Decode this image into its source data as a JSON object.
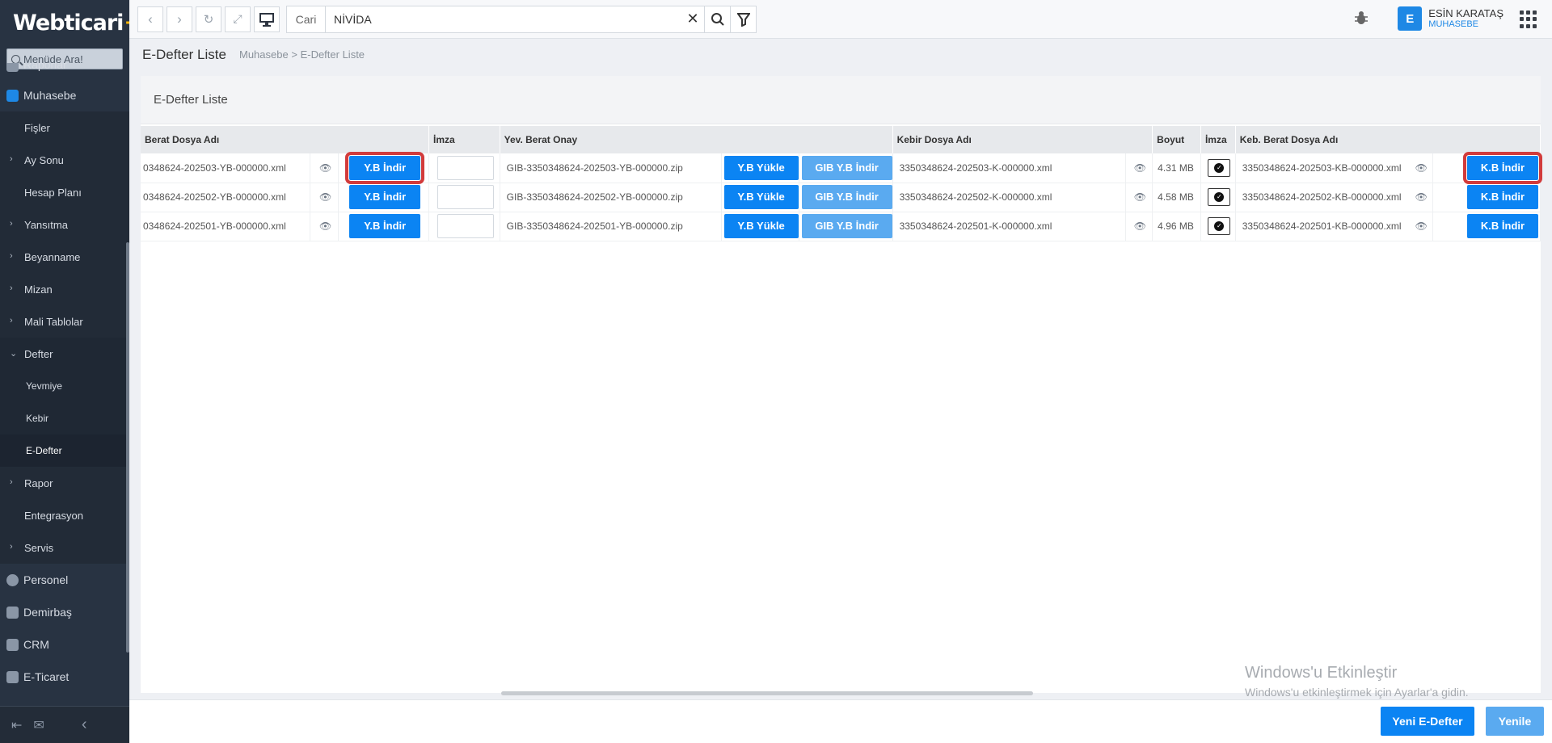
{
  "app": {
    "logo_text": "Webticari",
    "logo_plus": "+"
  },
  "sidebar": {
    "search_placeholder": "Menüde Ara!",
    "items": [
      {
        "label": "Raporlar"
      },
      {
        "label": "Muhasebe"
      },
      {
        "label": "Fişler"
      },
      {
        "label": "Ay Sonu"
      },
      {
        "label": "Hesap Planı"
      },
      {
        "label": "Yansıtma"
      },
      {
        "label": "Beyanname"
      },
      {
        "label": "Mizan"
      },
      {
        "label": "Mali Tablolar"
      },
      {
        "label": "Defter"
      },
      {
        "label": "Yevmiye"
      },
      {
        "label": "Kebir"
      },
      {
        "label": "E-Defter"
      },
      {
        "label": "Rapor"
      },
      {
        "label": "Entegrasyon"
      },
      {
        "label": "Servis"
      },
      {
        "label": "Personel"
      },
      {
        "label": "Demirbaş"
      },
      {
        "label": "CRM"
      },
      {
        "label": "E-Ticaret"
      }
    ]
  },
  "topbar": {
    "search_label": "Cari",
    "search_value": "NİVİDA",
    "user_initial": "E",
    "user_name": "ESİN KARATAŞ",
    "user_role": "MUHASEBE"
  },
  "page": {
    "title": "E-Defter Liste",
    "breadcrumb_1": "Muhasebe",
    "breadcrumb_sep": ">",
    "breadcrumb_2": "E-Defter Liste",
    "panel_title": "E-Defter Liste"
  },
  "table": {
    "headers": {
      "berat": "Berat Dosya Adı",
      "imza1": "İmza",
      "yev": "Yev. Berat Onay",
      "kebir": "Kebir Dosya Adı",
      "boyut": "Boyut",
      "imza2": "İmza",
      "keb_berat": "Keb. Berat Dosya Adı"
    },
    "buttons": {
      "yb_indir": "Y.B İndir",
      "yb_yukle": "Y.B Yükle",
      "gib_yb_indir": "GIB Y.B İndir",
      "kb_indir": "K.B İndir"
    },
    "rows": [
      {
        "berat": "0348624-202503-YB-000000.xml",
        "yev": "GIB-3350348624-202503-YB-000000.zip",
        "kebir": "3350348624-202503-K-000000.xml",
        "boyut": "4.31 MB",
        "keb_berat": "3350348624-202503-KB-000000.xml"
      },
      {
        "berat": "0348624-202502-YB-000000.xml",
        "yev": "GIB-3350348624-202502-YB-000000.zip",
        "kebir": "3350348624-202502-K-000000.xml",
        "boyut": "4.58 MB",
        "keb_berat": "3350348624-202502-KB-000000.xml"
      },
      {
        "berat": "0348624-202501-YB-000000.xml",
        "yev": "GIB-3350348624-202501-YB-000000.zip",
        "kebir": "3350348624-202501-K-000000.xml",
        "boyut": "4.96 MB",
        "keb_berat": "3350348624-202501-KB-000000.xml"
      }
    ]
  },
  "footer": {
    "new_label": "Yeni E-Defter",
    "refresh_label": "Yenile"
  },
  "watermark": {
    "line1": "Windows'u Etkinleştir",
    "line2": "Windows'u etkinleştirmek için Ayarlar'a gidin."
  },
  "colors": {
    "primary": "#0b84f3",
    "light_button": "#5aaaf0",
    "highlight": "#d23b3b",
    "sidebar": "#283342"
  }
}
